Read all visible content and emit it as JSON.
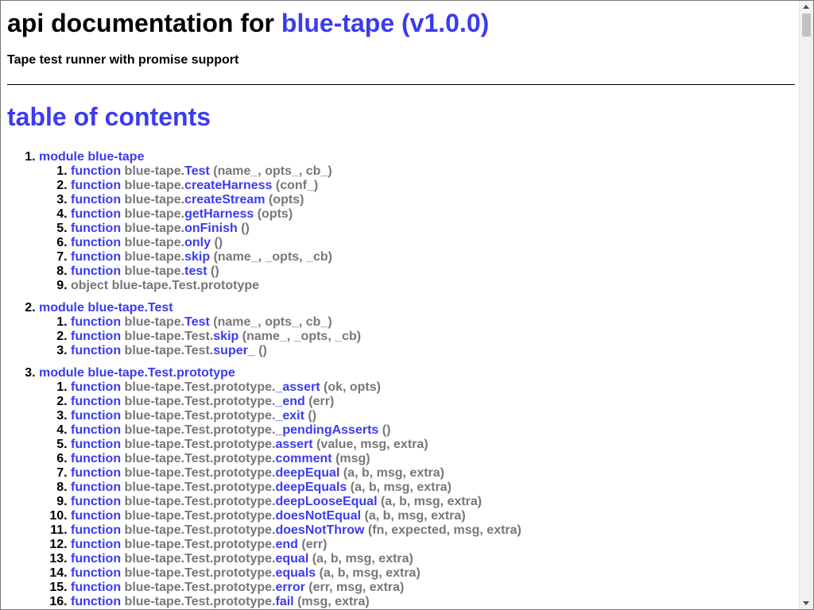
{
  "header": {
    "title_prefix": "api documentation for ",
    "package": "blue-tape (v1.0.0)",
    "description": "Tape test runner with promise support"
  },
  "toc": {
    "title": "table of contents",
    "modules": [
      {
        "keyword": "module",
        "name": "blue-tape",
        "members": [
          {
            "type": "function",
            "path": "blue-tape.",
            "name": "Test",
            "args": "(name_, opts_, cb_)"
          },
          {
            "type": "function",
            "path": "blue-tape.",
            "name": "createHarness",
            "args": "(conf_)"
          },
          {
            "type": "function",
            "path": "blue-tape.",
            "name": "createStream",
            "args": "(opts)"
          },
          {
            "type": "function",
            "path": "blue-tape.",
            "name": "getHarness",
            "args": "(opts)"
          },
          {
            "type": "function",
            "path": "blue-tape.",
            "name": "onFinish",
            "args": "()"
          },
          {
            "type": "function",
            "path": "blue-tape.",
            "name": "only",
            "args": "()"
          },
          {
            "type": "function",
            "path": "blue-tape.",
            "name": "skip",
            "args": "(name_, _opts, _cb)"
          },
          {
            "type": "function",
            "path": "blue-tape.",
            "name": "test",
            "args": "()"
          },
          {
            "type": "object",
            "text": "object blue-tape.Test.prototype"
          }
        ]
      },
      {
        "keyword": "module",
        "name": "blue-tape.Test",
        "members": [
          {
            "type": "function",
            "path": "blue-tape.",
            "name": "Test",
            "args": "(name_, opts_, cb_)"
          },
          {
            "type": "function",
            "path": "blue-tape.Test.",
            "name": "skip",
            "args": "(name_, _opts, _cb)"
          },
          {
            "type": "function",
            "path": "blue-tape.Test.",
            "name": "super_",
            "args": "()"
          }
        ]
      },
      {
        "keyword": "module",
        "name": "blue-tape.Test.prototype",
        "members": [
          {
            "type": "function",
            "path": "blue-tape.Test.prototype.",
            "name": "_assert",
            "args": "(ok, opts)"
          },
          {
            "type": "function",
            "path": "blue-tape.Test.prototype.",
            "name": "_end",
            "args": "(err)"
          },
          {
            "type": "function",
            "path": "blue-tape.Test.prototype.",
            "name": "_exit",
            "args": "()"
          },
          {
            "type": "function",
            "path": "blue-tape.Test.prototype.",
            "name": "_pendingAsserts",
            "args": "()"
          },
          {
            "type": "function",
            "path": "blue-tape.Test.prototype.",
            "name": "assert",
            "args": "(value, msg, extra)"
          },
          {
            "type": "function",
            "path": "blue-tape.Test.prototype.",
            "name": "comment",
            "args": "(msg)"
          },
          {
            "type": "function",
            "path": "blue-tape.Test.prototype.",
            "name": "deepEqual",
            "args": "(a, b, msg, extra)"
          },
          {
            "type": "function",
            "path": "blue-tape.Test.prototype.",
            "name": "deepEquals",
            "args": "(a, b, msg, extra)"
          },
          {
            "type": "function",
            "path": "blue-tape.Test.prototype.",
            "name": "deepLooseEqual",
            "args": "(a, b, msg, extra)"
          },
          {
            "type": "function",
            "path": "blue-tape.Test.prototype.",
            "name": "doesNotEqual",
            "args": "(a, b, msg, extra)"
          },
          {
            "type": "function",
            "path": "blue-tape.Test.prototype.",
            "name": "doesNotThrow",
            "args": "(fn, expected, msg, extra)"
          },
          {
            "type": "function",
            "path": "blue-tape.Test.prototype.",
            "name": "end",
            "args": "(err)"
          },
          {
            "type": "function",
            "path": "blue-tape.Test.prototype.",
            "name": "equal",
            "args": "(a, b, msg, extra)"
          },
          {
            "type": "function",
            "path": "blue-tape.Test.prototype.",
            "name": "equals",
            "args": "(a, b, msg, extra)"
          },
          {
            "type": "function",
            "path": "blue-tape.Test.prototype.",
            "name": "error",
            "args": "(err, msg, extra)"
          },
          {
            "type": "function",
            "path": "blue-tape.Test.prototype.",
            "name": "fail",
            "args": "(msg, extra)"
          }
        ]
      }
    ]
  }
}
